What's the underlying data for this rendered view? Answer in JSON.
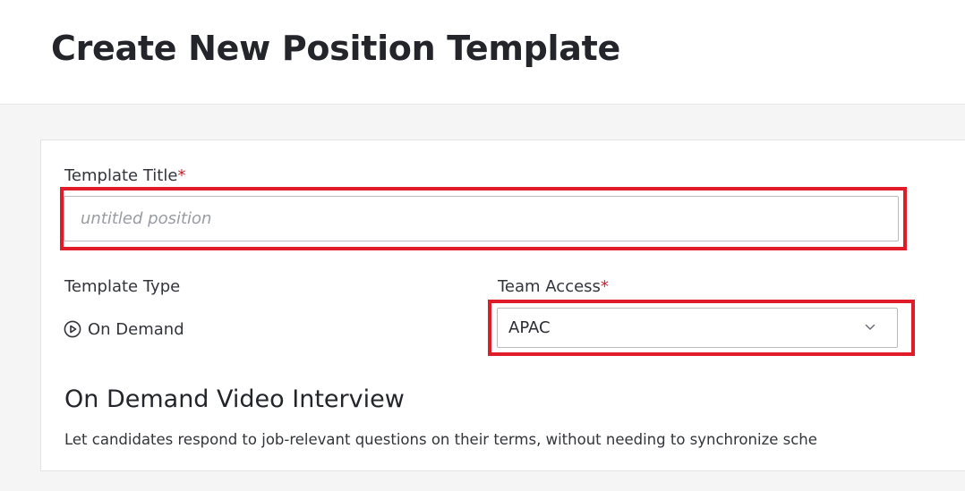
{
  "header": {
    "title": "Create New Position Template"
  },
  "form": {
    "template_title": {
      "label": "Template Title",
      "required_mark": "*",
      "placeholder": "untitled position",
      "value": ""
    },
    "template_type": {
      "label": "Template Type",
      "value": "On Demand",
      "icon": "play-circle-icon"
    },
    "team_access": {
      "label": "Team Access",
      "required_mark": "*",
      "selected": "APAC",
      "icon": "chevron-down-icon"
    },
    "section": {
      "title": "On Demand Video Interview",
      "description": "Let candidates respond to job-relevant questions on their terms, without needing to synchronize sche"
    }
  },
  "colors": {
    "highlight": "#e01b2a",
    "required": "#c3202b",
    "text": "#2b2d33",
    "background": "#f5f5f6"
  }
}
